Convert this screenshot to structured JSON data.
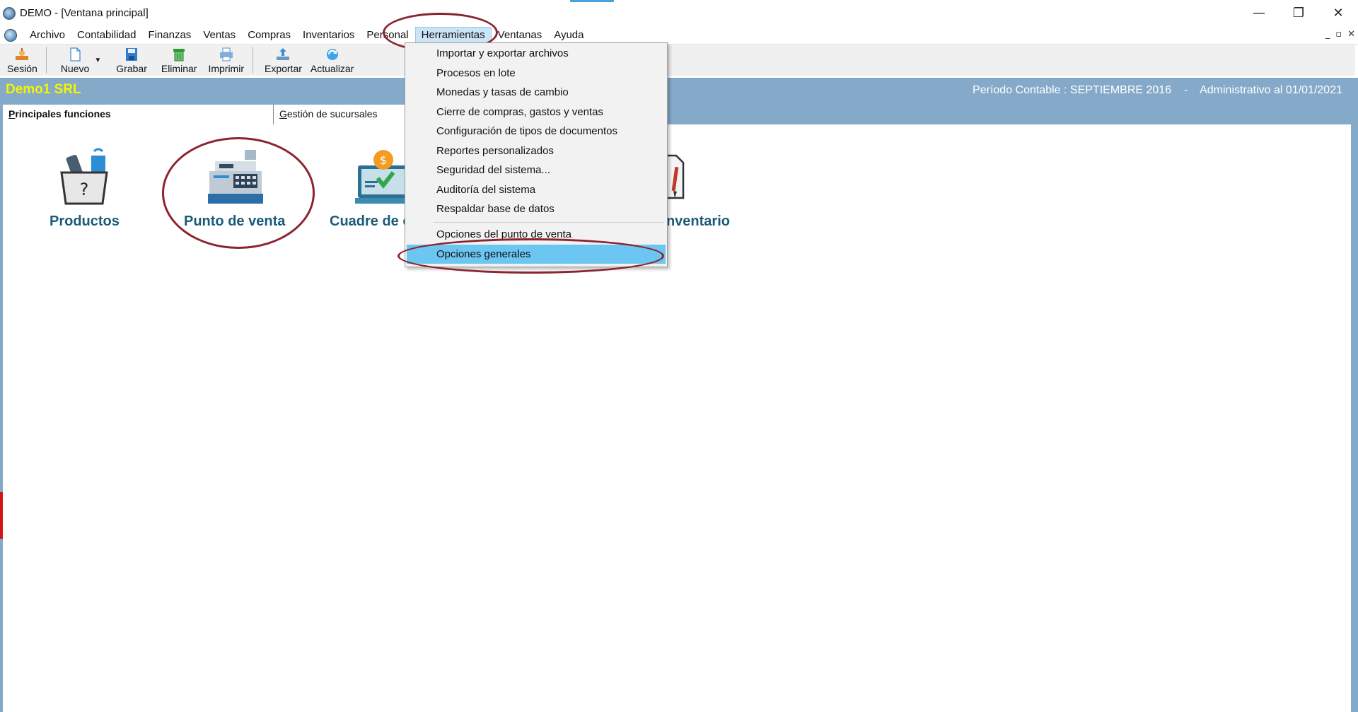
{
  "window": {
    "title": "DEMO - [Ventana principal]",
    "controls": [
      "—",
      "❐",
      "✕"
    ]
  },
  "menubar": {
    "items": [
      {
        "label": "Archivo",
        "active": false
      },
      {
        "label": "Contabilidad",
        "active": false
      },
      {
        "label": "Finanzas",
        "active": false
      },
      {
        "label": "Ventas",
        "active": false
      },
      {
        "label": "Compras",
        "active": false
      },
      {
        "label": "Inventarios",
        "active": false
      },
      {
        "label": "Personal",
        "active": false
      },
      {
        "label": "Herramientas",
        "active": true
      },
      {
        "label": "Ventanas",
        "active": false
      },
      {
        "label": "Ayuda",
        "active": false
      }
    ],
    "mdi_controls": [
      "_",
      "▫",
      "✕"
    ]
  },
  "toolbar": {
    "sesion": "Sesión",
    "nuevo": "Nuevo",
    "grabar": "Grabar",
    "eliminar": "Eliminar",
    "imprimir": "Imprimir",
    "exportar": "Exportar",
    "actualizar": "Actualizar"
  },
  "header": {
    "company": "Demo1 SRL",
    "period": "Período Contable : SEPTIEMBRE 2016    -    Administrativo al 01/01/2021"
  },
  "tabs": {
    "active_prefix": "P",
    "active_rest": "rincipales funciones",
    "inactive_prefix": "G",
    "inactive_rest": "estión de sucursales"
  },
  "functions": {
    "productos": "Productos",
    "punto_venta": "Punto de venta",
    "cuadre": "Cuadre de c",
    "inventario": "nventario"
  },
  "dropdown": {
    "items": [
      "Importar y exportar archivos",
      "Procesos en lote",
      "Monedas y tasas de cambio",
      "Cierre de compras, gastos y ventas",
      "Configuración de tipos de documentos",
      "Reportes personalizados",
      "Seguridad del sistema...",
      "Auditoría del sistema",
      "Respaldar base de datos"
    ],
    "extra_items": [
      "Opciones del punto de venta",
      "Opciones generales"
    ]
  },
  "colors": {
    "header_bg": "#85a9c9",
    "company_text": "#f5f500",
    "highlight": "#6cc6f2",
    "annotation": "#8b2430",
    "function_label": "#1c5a7a"
  }
}
